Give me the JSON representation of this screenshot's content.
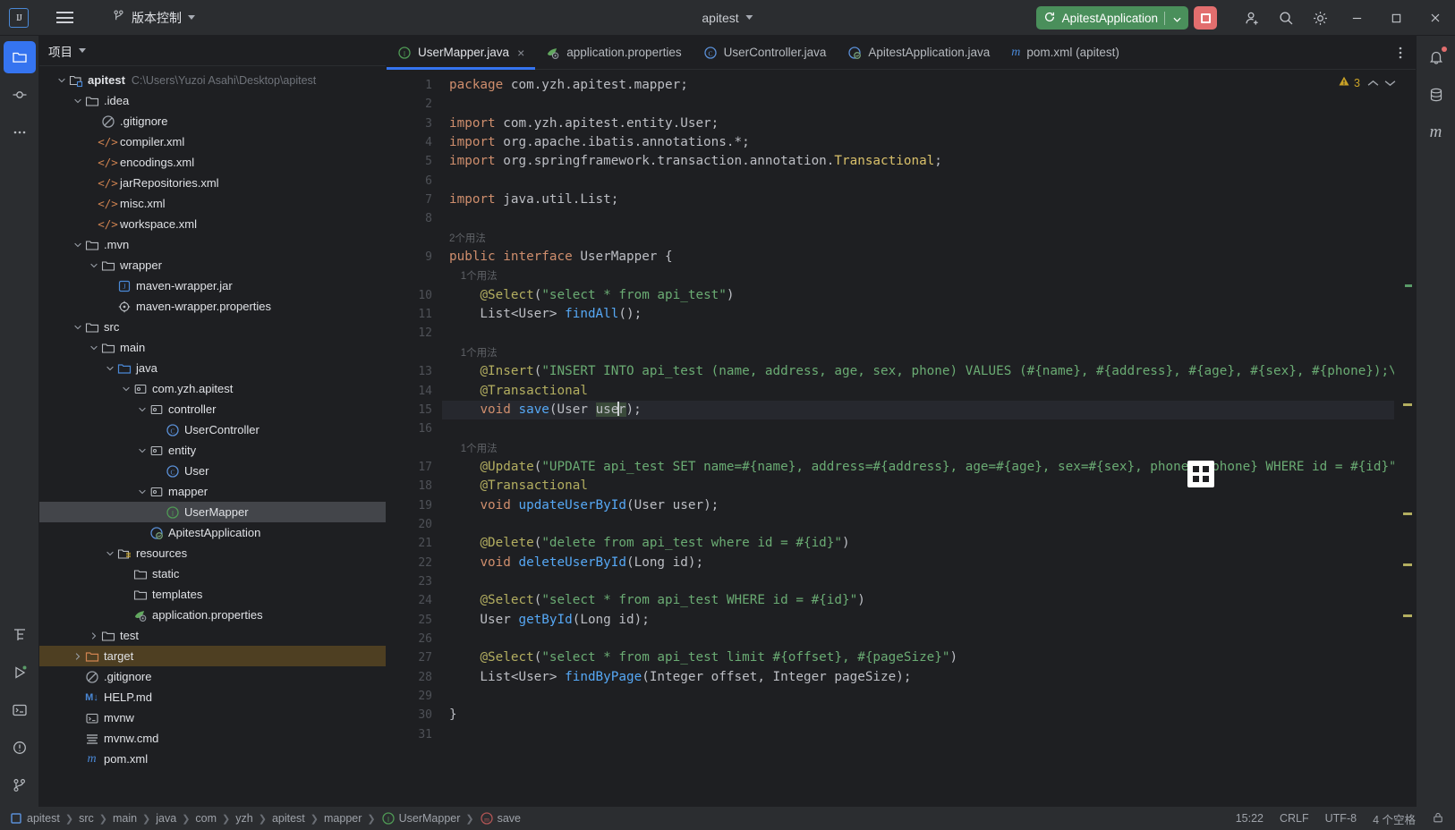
{
  "titlebar": {
    "logo_icon": "intellij-idea-logo-icon",
    "menu_icon": "hamburger-menu-icon",
    "vcs": {
      "icon": "vcs-branch-icon",
      "label": "版本控制",
      "chevron": "chevron-down-icon"
    },
    "project": {
      "label": "apitest",
      "chevron": "chevron-down-icon"
    },
    "run_config": {
      "icon": "rerun-icon",
      "label": "ApitestApplication",
      "chevron": "chevron-down-icon",
      "color": "#4a8f5b"
    },
    "stop_button": {
      "icon": "stop-square-icon",
      "color": "#e26e6e"
    },
    "actions": [
      "add-user-icon",
      "search-icon",
      "gear-icon"
    ],
    "window_controls": [
      "minimize-icon",
      "maximize-icon",
      "close-icon"
    ]
  },
  "left_activity_bar": {
    "items": [
      {
        "icon": "project-folder-icon",
        "selected": true
      },
      {
        "icon": "commit-icon",
        "selected": false
      },
      {
        "icon": "more-dots-icon",
        "selected": false
      }
    ],
    "bottom_items": [
      {
        "icon": "structure-icon"
      },
      {
        "icon": "run-icon"
      },
      {
        "icon": "terminal-icon"
      },
      {
        "icon": "problems-icon"
      },
      {
        "icon": "git-branch-icon"
      }
    ]
  },
  "right_activity_bar": {
    "items": [
      {
        "icon": "notifications-bell-icon"
      },
      {
        "icon": "database-icon"
      },
      {
        "icon": "maven-m-icon"
      }
    ]
  },
  "project_pane": {
    "title": "项目",
    "chevron": "chevron-down-icon",
    "tree": [
      {
        "depth": 0,
        "twisty": "expanded",
        "icon": "module-folder-icon",
        "label": "apitest",
        "bold": true,
        "path": "C:\\Users\\Yuzoi Asahi\\Desktop\\apitest"
      },
      {
        "depth": 1,
        "twisty": "expanded",
        "icon": "folder-icon",
        "label": ".idea"
      },
      {
        "depth": 2,
        "twisty": "none",
        "icon": "gitignore-icon",
        "label": ".gitignore"
      },
      {
        "depth": 2,
        "twisty": "none",
        "icon": "xml-file-icon",
        "label": "compiler.xml"
      },
      {
        "depth": 2,
        "twisty": "none",
        "icon": "xml-file-icon",
        "label": "encodings.xml"
      },
      {
        "depth": 2,
        "twisty": "none",
        "icon": "xml-file-icon",
        "label": "jarRepositories.xml"
      },
      {
        "depth": 2,
        "twisty": "none",
        "icon": "xml-file-icon",
        "label": "misc.xml"
      },
      {
        "depth": 2,
        "twisty": "none",
        "icon": "xml-file-icon",
        "label": "workspace.xml"
      },
      {
        "depth": 1,
        "twisty": "expanded",
        "icon": "folder-icon",
        "label": ".mvn"
      },
      {
        "depth": 2,
        "twisty": "expanded",
        "icon": "folder-icon",
        "label": "wrapper"
      },
      {
        "depth": 3,
        "twisty": "none",
        "icon": "jar-file-icon",
        "label": "maven-wrapper.jar"
      },
      {
        "depth": 3,
        "twisty": "none",
        "icon": "properties-file-icon",
        "label": "maven-wrapper.properties"
      },
      {
        "depth": 1,
        "twisty": "expanded",
        "icon": "folder-icon",
        "label": "src"
      },
      {
        "depth": 2,
        "twisty": "expanded",
        "icon": "folder-icon",
        "label": "main"
      },
      {
        "depth": 3,
        "twisty": "expanded",
        "icon": "source-root-icon",
        "label": "java"
      },
      {
        "depth": 4,
        "twisty": "expanded",
        "icon": "package-icon",
        "label": "com.yzh.apitest"
      },
      {
        "depth": 5,
        "twisty": "expanded",
        "icon": "package-icon",
        "label": "controller"
      },
      {
        "depth": 6,
        "twisty": "none",
        "icon": "java-class-icon",
        "label": "UserController"
      },
      {
        "depth": 5,
        "twisty": "expanded",
        "icon": "package-icon",
        "label": "entity"
      },
      {
        "depth": 6,
        "twisty": "none",
        "icon": "java-class-icon",
        "label": "User"
      },
      {
        "depth": 5,
        "twisty": "expanded",
        "icon": "package-icon",
        "label": "mapper"
      },
      {
        "depth": 6,
        "twisty": "none",
        "icon": "java-interface-icon",
        "label": "UserMapper",
        "selected": true
      },
      {
        "depth": 5,
        "twisty": "none",
        "icon": "spring-boot-class-icon",
        "label": "ApitestApplication"
      },
      {
        "depth": 3,
        "twisty": "expanded",
        "icon": "resources-root-icon",
        "label": "resources"
      },
      {
        "depth": 4,
        "twisty": "none",
        "icon": "folder-icon",
        "label": "static"
      },
      {
        "depth": 4,
        "twisty": "none",
        "icon": "folder-icon",
        "label": "templates"
      },
      {
        "depth": 4,
        "twisty": "none",
        "icon": "spring-properties-icon",
        "label": "application.properties"
      },
      {
        "depth": 2,
        "twisty": "collapsed",
        "icon": "folder-icon",
        "label": "test"
      },
      {
        "depth": 1,
        "twisty": "collapsed",
        "icon": "excluded-folder-icon",
        "label": "target",
        "marked": true
      },
      {
        "depth": 1,
        "twisty": "none",
        "icon": "gitignore-icon",
        "label": ".gitignore"
      },
      {
        "depth": 1,
        "twisty": "none",
        "icon": "markdown-file-icon",
        "label": "HELP.md"
      },
      {
        "depth": 1,
        "twisty": "none",
        "icon": "shell-script-icon",
        "label": "mvnw"
      },
      {
        "depth": 1,
        "twisty": "none",
        "icon": "text-file-icon",
        "label": "mvnw.cmd"
      },
      {
        "depth": 1,
        "twisty": "none",
        "icon": "maven-pom-icon",
        "label": "pom.xml"
      }
    ]
  },
  "editor_tabs": {
    "more_icon": "more-vertical-icon",
    "items": [
      {
        "icon": "java-interface-icon",
        "label": "UserMapper.java",
        "active": true,
        "close_icon": "close-icon"
      },
      {
        "icon": "spring-properties-icon",
        "label": "application.properties",
        "active": false
      },
      {
        "icon": "java-class-icon",
        "label": "UserController.java",
        "active": false
      },
      {
        "icon": "spring-boot-class-icon",
        "label": "ApitestApplication.java",
        "active": false
      },
      {
        "icon": "maven-pom-icon",
        "label": "pom.xml (apitest)",
        "active": false
      }
    ]
  },
  "editor": {
    "inspection_badge": {
      "icon": "warning-triangle-icon",
      "count": "3",
      "up_icon": "chevron-up-icon",
      "down_icon": "chevron-down-icon"
    },
    "caret_line": 15,
    "line_numbers": [
      1,
      2,
      3,
      4,
      5,
      6,
      7,
      8,
      9,
      10,
      11,
      12,
      13,
      14,
      15,
      16,
      17,
      18,
      19,
      20,
      21,
      22,
      23,
      24,
      25,
      26,
      27,
      28,
      29,
      30,
      31
    ],
    "inlay_hints": {
      "9": "2个用法",
      "10": "1个用法",
      "13": "1个用法",
      "17": "1个用法"
    },
    "lines": [
      {
        "n": 1,
        "tokens": [
          {
            "t": "package ",
            "c": "kw"
          },
          {
            "t": "com.yzh.apitest.mapper;",
            "c": "pun"
          }
        ]
      },
      {
        "n": 2,
        "tokens": []
      },
      {
        "n": 3,
        "tokens": [
          {
            "t": "import ",
            "c": "kw"
          },
          {
            "t": "com.yzh.apitest.entity.User;",
            "c": "pun"
          }
        ]
      },
      {
        "n": 4,
        "tokens": [
          {
            "t": "import ",
            "c": "kw"
          },
          {
            "t": "org.apache.ibatis.annotations.*;",
            "c": "pun"
          }
        ]
      },
      {
        "n": 5,
        "tokens": [
          {
            "t": "import ",
            "c": "kw"
          },
          {
            "t": "org.springframework.transaction.annotation.",
            "c": "pun"
          },
          {
            "t": "Transactional",
            "c": "cls"
          },
          {
            "t": ";",
            "c": "pun"
          }
        ]
      },
      {
        "n": 6,
        "tokens": []
      },
      {
        "n": 7,
        "tokens": [
          {
            "t": "import ",
            "c": "kw"
          },
          {
            "t": "java.util.List;",
            "c": "pun"
          }
        ]
      },
      {
        "n": 8,
        "tokens": []
      },
      {
        "n": 9,
        "hint": "2个用法",
        "hint_indent": 0,
        "tokens": [
          {
            "t": "public interface ",
            "c": "kw"
          },
          {
            "t": "UserMapper",
            "c": "typ"
          },
          {
            "t": " {",
            "c": "pun"
          }
        ]
      },
      {
        "n": 10,
        "hint": "1个用法",
        "hint_indent": 1,
        "tokens": [
          {
            "t": "    ",
            "c": "pun"
          },
          {
            "t": "@Select",
            "c": "ann"
          },
          {
            "t": "(",
            "c": "pun"
          },
          {
            "t": "\"select * from api_test\"",
            "c": "str"
          },
          {
            "t": ")",
            "c": "pun"
          }
        ]
      },
      {
        "n": 11,
        "tokens": [
          {
            "t": "    List<User> ",
            "c": "typ"
          },
          {
            "t": "findAll",
            "c": "fn"
          },
          {
            "t": "();",
            "c": "pun"
          }
        ]
      },
      {
        "n": 12,
        "tokens": []
      },
      {
        "n": 13,
        "hint": "1个用法",
        "hint_indent": 1,
        "tokens": [
          {
            "t": "    ",
            "c": "pun"
          },
          {
            "t": "@Insert",
            "c": "ann"
          },
          {
            "t": "(",
            "c": "pun"
          },
          {
            "t": "\"INSERT INTO api_test (name, address, age, sex, phone) VALUES (#{name}, #{address}, #{age}, #{sex}, #{phone});\\n\"",
            "c": "str"
          },
          {
            "t": ")",
            "c": "pun"
          }
        ]
      },
      {
        "n": 14,
        "tokens": [
          {
            "t": "    ",
            "c": "pun"
          },
          {
            "t": "@Transactional",
            "c": "ann"
          }
        ]
      },
      {
        "n": 15,
        "caret": true,
        "tokens": [
          {
            "t": "    ",
            "c": "pun"
          },
          {
            "t": "void ",
            "c": "kw"
          },
          {
            "t": "save",
            "c": "fn"
          },
          {
            "t": "(",
            "c": "pun"
          },
          {
            "t": "User ",
            "c": "typ"
          },
          {
            "t": "user",
            "c": "sel-ident"
          },
          {
            "t": ");",
            "c": "pun"
          }
        ]
      },
      {
        "n": 16,
        "tokens": []
      },
      {
        "n": 17,
        "hint": "1个用法",
        "hint_indent": 1,
        "tokens": [
          {
            "t": "    ",
            "c": "pun"
          },
          {
            "t": "@Update",
            "c": "ann"
          },
          {
            "t": "(",
            "c": "pun"
          },
          {
            "t": "\"UPDATE api_test SET name=#{name}, address=#{address}, age=#{age}, sex=#{sex}, phone=#{phone} WHERE id = #{id}\"",
            "c": "str"
          },
          {
            "t": ")",
            "c": "pun"
          }
        ]
      },
      {
        "n": 18,
        "tokens": [
          {
            "t": "    ",
            "c": "pun"
          },
          {
            "t": "@Transactional",
            "c": "ann"
          }
        ]
      },
      {
        "n": 19,
        "tokens": [
          {
            "t": "    ",
            "c": "pun"
          },
          {
            "t": "void ",
            "c": "kw"
          },
          {
            "t": "updateUserById",
            "c": "fn"
          },
          {
            "t": "(",
            "c": "pun"
          },
          {
            "t": "User user",
            "c": "typ"
          },
          {
            "t": ");",
            "c": "pun"
          }
        ]
      },
      {
        "n": 20,
        "tokens": []
      },
      {
        "n": 21,
        "tokens": [
          {
            "t": "    ",
            "c": "pun"
          },
          {
            "t": "@Delete",
            "c": "ann"
          },
          {
            "t": "(",
            "c": "pun"
          },
          {
            "t": "\"delete from api_test where id = #{id}\"",
            "c": "str"
          },
          {
            "t": ")",
            "c": "pun"
          }
        ]
      },
      {
        "n": 22,
        "tokens": [
          {
            "t": "    ",
            "c": "pun"
          },
          {
            "t": "void ",
            "c": "kw"
          },
          {
            "t": "deleteUserById",
            "c": "fn"
          },
          {
            "t": "(",
            "c": "pun"
          },
          {
            "t": "Long id",
            "c": "typ"
          },
          {
            "t": ");",
            "c": "pun"
          }
        ]
      },
      {
        "n": 23,
        "tokens": []
      },
      {
        "n": 24,
        "tokens": [
          {
            "t": "    ",
            "c": "pun"
          },
          {
            "t": "@Select",
            "c": "ann"
          },
          {
            "t": "(",
            "c": "pun"
          },
          {
            "t": "\"select * from api_test WHERE id = #{id}\"",
            "c": "str"
          },
          {
            "t": ")",
            "c": "pun"
          }
        ]
      },
      {
        "n": 25,
        "tokens": [
          {
            "t": "    User ",
            "c": "typ"
          },
          {
            "t": "getById",
            "c": "fn"
          },
          {
            "t": "(",
            "c": "pun"
          },
          {
            "t": "Long id",
            "c": "typ"
          },
          {
            "t": ");",
            "c": "pun"
          }
        ]
      },
      {
        "n": 26,
        "tokens": []
      },
      {
        "n": 27,
        "tokens": [
          {
            "t": "    ",
            "c": "pun"
          },
          {
            "t": "@Select",
            "c": "ann"
          },
          {
            "t": "(",
            "c": "pun"
          },
          {
            "t": "\"select * from api_test limit #{offset}, #{pageSize}\"",
            "c": "str"
          },
          {
            "t": ")",
            "c": "pun"
          }
        ]
      },
      {
        "n": 28,
        "tokens": [
          {
            "t": "    List<User> ",
            "c": "typ"
          },
          {
            "t": "findByPage",
            "c": "fn"
          },
          {
            "t": "(",
            "c": "pun"
          },
          {
            "t": "Integer offset, Integer pageSize",
            "c": "typ"
          },
          {
            "t": ");",
            "c": "pun"
          }
        ]
      },
      {
        "n": 29,
        "tokens": []
      },
      {
        "n": 30,
        "tokens": [
          {
            "t": "}",
            "c": "pun"
          }
        ]
      },
      {
        "n": 31,
        "tokens": []
      }
    ],
    "floating_cursor_icon": "mouse-cursor-icon"
  },
  "breadcrumbs": [
    {
      "icon": "module-icon",
      "label": "apitest"
    },
    {
      "icon": "",
      "label": "src"
    },
    {
      "icon": "",
      "label": "main"
    },
    {
      "icon": "",
      "label": "java"
    },
    {
      "icon": "",
      "label": "com"
    },
    {
      "icon": "",
      "label": "yzh"
    },
    {
      "icon": "",
      "label": "apitest"
    },
    {
      "icon": "",
      "label": "mapper"
    },
    {
      "icon": "java-interface-icon",
      "label": "UserMapper"
    },
    {
      "icon": "method-icon",
      "label": "save"
    }
  ],
  "status_bar": {
    "time": "15:22",
    "line_separator": "CRLF",
    "encoding": "UTF-8",
    "indent": "4 个空格",
    "lock_icon": "lock-icon"
  },
  "colors": {
    "accent": "#3574f0",
    "run_green": "#4a8f5b",
    "stop_red": "#e26e6e",
    "bg_editor": "#1e1f22",
    "bg_chrome": "#2b2d30",
    "selection": "#43454a",
    "marked_row": "#4e3f22",
    "warning": "#c9a227"
  }
}
